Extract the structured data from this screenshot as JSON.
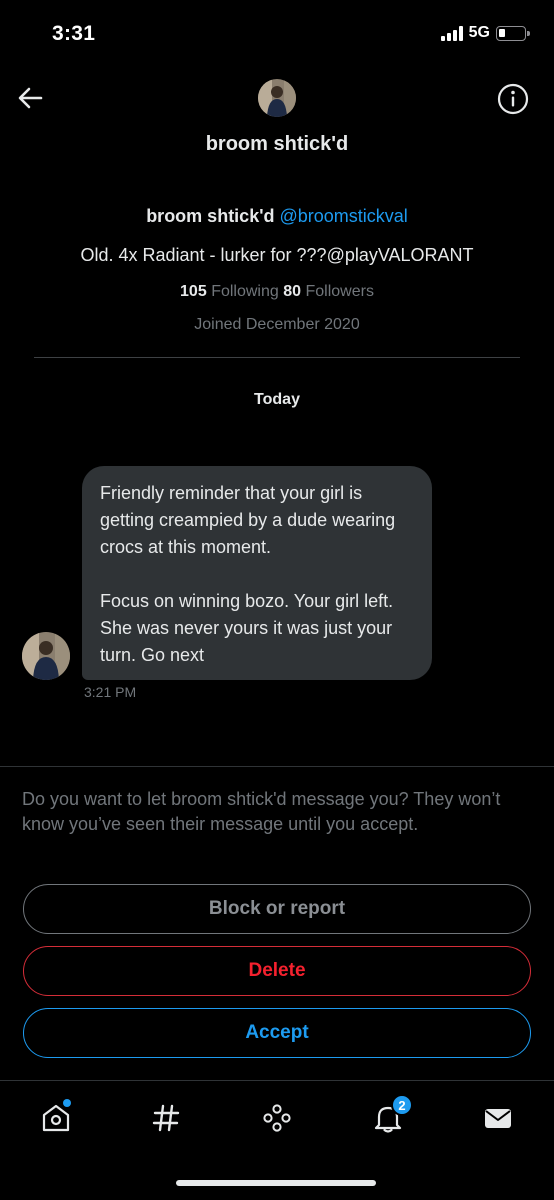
{
  "status_bar": {
    "time": "3:31",
    "network": "5G"
  },
  "header": {
    "title": "broom shtick'd",
    "back_icon": "arrow-left-icon",
    "info_icon": "info-circle-icon"
  },
  "profile": {
    "name": "broom shtick'd",
    "handle": "@broomstickval",
    "bio": "Old. 4x Radiant - lurker for ???@playVALORANT",
    "following_count": "105",
    "following_label": "Following",
    "followers_count": "80",
    "followers_label": "Followers",
    "joined": "Joined December 2020"
  },
  "conversation": {
    "day_label": "Today",
    "message": {
      "text": "Friendly reminder that your girl is getting creampied by a dude wearing crocs at this moment.\n\nFocus on winning bozo. Your girl left. She was never yours it was just your turn. Go next",
      "time": "3:21 PM"
    }
  },
  "request": {
    "prompt": "Do you want to let broom shtick'd message you? They won’t know you’ve seen their message until you accept.",
    "block_label": "Block or report",
    "delete_label": "Delete",
    "accept_label": "Accept"
  },
  "bottom_nav": {
    "items": [
      "home-icon",
      "explore-hashtag-icon",
      "spaces-icon",
      "notifications-bell-icon",
      "messages-envelope-icon"
    ],
    "notification_badge": "2"
  },
  "colors": {
    "background": "#000000",
    "accent": "#1d9bf0",
    "danger": "#f4212e",
    "bubble": "#2f3336",
    "muted": "#71767b"
  }
}
